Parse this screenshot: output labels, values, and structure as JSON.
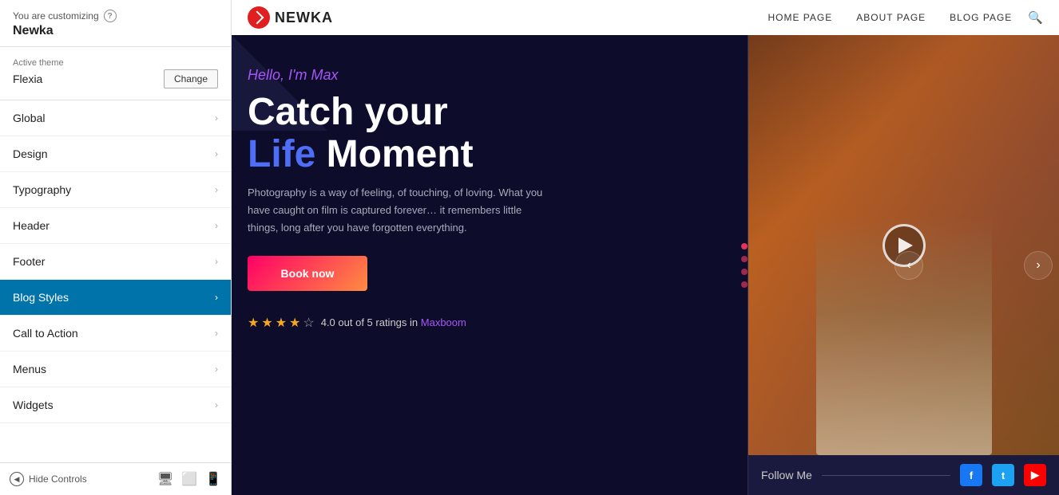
{
  "customizer": {
    "you_are_customizing": "You are customizing",
    "help_label": "?",
    "theme_name": "Newka",
    "active_theme_label": "Active theme",
    "active_theme_value": "Flexia",
    "change_button": "Change"
  },
  "nav_items": [
    {
      "id": "global",
      "label": "Global",
      "active": false
    },
    {
      "id": "design",
      "label": "Design",
      "active": false
    },
    {
      "id": "typography",
      "label": "Typography",
      "active": false
    },
    {
      "id": "header",
      "label": "Header",
      "active": false
    },
    {
      "id": "footer",
      "label": "Footer",
      "active": false
    },
    {
      "id": "blog-styles",
      "label": "Blog Styles",
      "active": true
    },
    {
      "id": "call-to-action",
      "label": "Call to Action",
      "active": false
    },
    {
      "id": "menus",
      "label": "Menus",
      "active": false
    },
    {
      "id": "widgets",
      "label": "Widgets",
      "active": false
    }
  ],
  "bottom_controls": {
    "hide_controls": "Hide Controls",
    "device_desktop": "🖥",
    "device_tablet": "📱",
    "device_mobile": "📱"
  },
  "preview": {
    "logo_text": "NEWKA",
    "nav_links": [
      "HOME PAGE",
      "ABOUT PAGE",
      "BLOG PAGE"
    ],
    "hero": {
      "greeting": "Hello, I'm Max",
      "title_line1": "Catch your",
      "title_line2_blue": "Life",
      "title_line2_white": " Moment",
      "description": "Photography is a way of feeling, of touching, of loving. What you have caught on film is captured forever… it remembers little things, long after you have forgotten everything.",
      "book_now": "Book now",
      "rating_text": "4.0 out of 5 ratings in",
      "rating_brand": "Maxboom",
      "follow_me": "Follow Me"
    }
  }
}
